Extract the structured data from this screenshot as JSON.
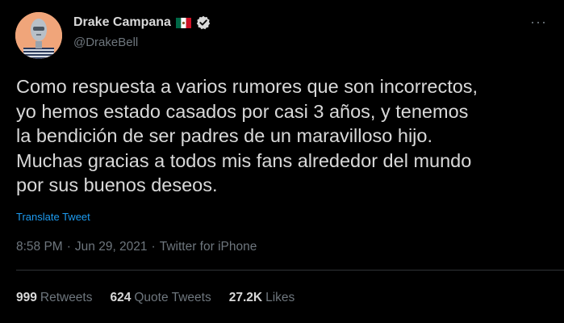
{
  "author": {
    "display_name": "Drake Campana",
    "handle": "@DrakeBell",
    "flag_icon": "mexico-flag-icon",
    "verified_icon": "verified-badge-icon"
  },
  "tweet": {
    "text": "Como respuesta a varios rumores que son incorrectos,\nyo hemos estado casados por casi 3 años, y tenemos\nla bendición de ser padres de un maravilloso hijo.\nMuchas gracias a todos mis fans alrededor del mundo\npor sus buenos deseos.",
    "translate_label": "Translate Tweet",
    "time": "8:58 PM",
    "date": "Jun 29, 2021",
    "separator": "·",
    "source": "Twitter for iPhone"
  },
  "stats": {
    "retweets_count": "999",
    "retweets_label": "Retweets",
    "quotes_count": "624",
    "quotes_label": "Quote Tweets",
    "likes_count": "27.2K",
    "likes_label": "Likes"
  },
  "colors": {
    "background": "#000000",
    "text": "#d9d9d9",
    "muted": "#6e767d",
    "link": "#1d9bf0",
    "divider": "#2f3336"
  }
}
